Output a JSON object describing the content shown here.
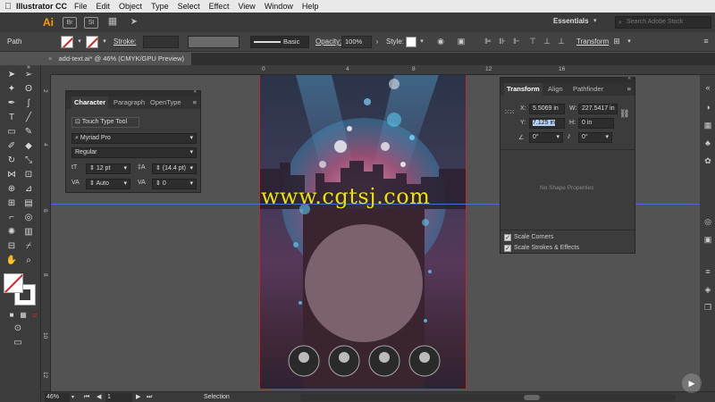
{
  "menubar": {
    "app_name": "Illustrator CC",
    "items": [
      "File",
      "Edit",
      "Object",
      "Type",
      "Select",
      "Effect",
      "View",
      "Window",
      "Help"
    ]
  },
  "appbar": {
    "logo": "Ai",
    "bridge": "Br",
    "stock": "St",
    "workspace": "Essentials",
    "search_placeholder": "Search Adobe Stock"
  },
  "control": {
    "selection_type": "Path",
    "stroke_label": "Stroke:",
    "brush_label": "Basic",
    "opacity_label": "Opacity:",
    "opacity_value": "100%",
    "style_label": "Style:",
    "transform_label": "Transform"
  },
  "document": {
    "tab_title": "add-text.ai* @ 46% (CMYK/GPU Preview)"
  },
  "rulers": {
    "top": [
      "0",
      "4",
      "8",
      "12",
      "16"
    ],
    "left": [
      "2",
      "4",
      "6",
      "8",
      "10",
      "12"
    ]
  },
  "character_panel": {
    "tabs": [
      "Character",
      "Paragraph",
      "OpenType"
    ],
    "touch_type": "Touch Type Tool",
    "font_family": "Myriad Pro",
    "font_style": "Regular",
    "font_size": "12 pt",
    "leading": "(14.4 pt)",
    "kerning": "Auto",
    "tracking": "0"
  },
  "transform_panel": {
    "tabs": [
      "Transform",
      "Align",
      "Pathfinder"
    ],
    "x_label": "X:",
    "x_value": "5.5069 in",
    "y_label": "Y:",
    "y_value": "7.125 in",
    "w_label": "W:",
    "w_value": "227.5417 in",
    "h_label": "H:",
    "h_value": "0 in",
    "rotate_value": "0°",
    "shear_value": "0°",
    "no_shape": "No Shape Properties",
    "scale_corners": "Scale Corners",
    "scale_strokes": "Scale Strokes & Effects"
  },
  "status": {
    "zoom": "46%",
    "artboard": "1",
    "mode": "Selection"
  },
  "watermark": "www.cgtsj.com",
  "colors": {
    "artboard_border": "#c1272d",
    "guide": "#4f6ad8",
    "watermark": "#f0e200"
  }
}
